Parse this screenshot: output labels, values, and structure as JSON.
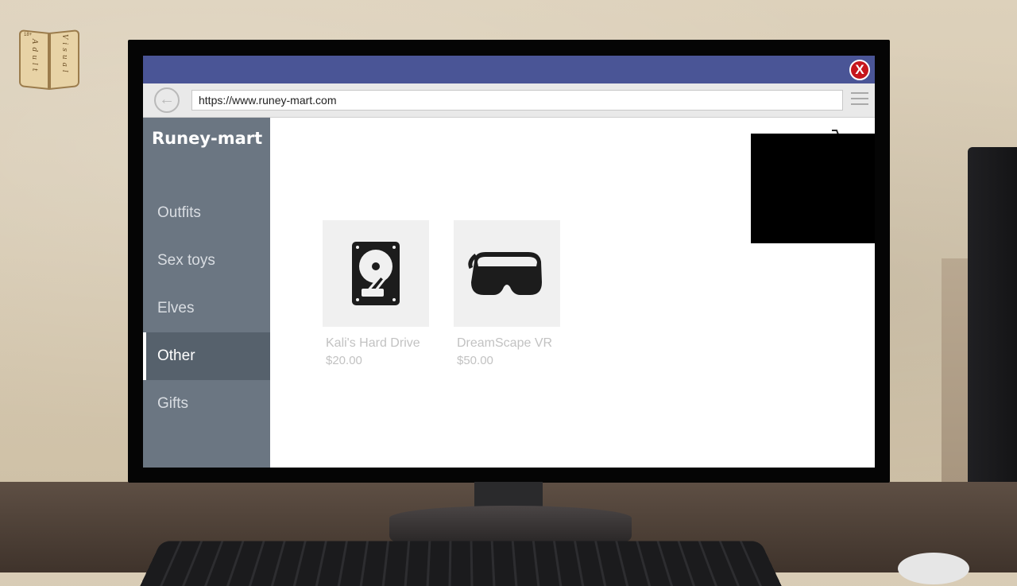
{
  "browser": {
    "url": "https://www.runey-mart.com",
    "close_label": "X",
    "back_label": "←"
  },
  "site": {
    "brand": "Runey-mart"
  },
  "sidebar": {
    "items": [
      {
        "label": "Outfits"
      },
      {
        "label": "Sex toys"
      },
      {
        "label": "Elves"
      },
      {
        "label": "Other",
        "active": true
      },
      {
        "label": "Gifts"
      }
    ]
  },
  "products": [
    {
      "name": "Kali's Hard Drive",
      "price": "$20.00",
      "icon": "hard-drive-icon"
    },
    {
      "name": "DreamScape VR",
      "price": "$50.00",
      "icon": "vr-headset-icon"
    }
  ],
  "logo": {
    "age": "18+",
    "left_word": "Adult",
    "right_word": "Visual"
  },
  "colors": {
    "titlebar": "#4a5596",
    "sidebar": "#6b7682",
    "sidebar_active": "#56616c",
    "close": "#c6161c"
  }
}
